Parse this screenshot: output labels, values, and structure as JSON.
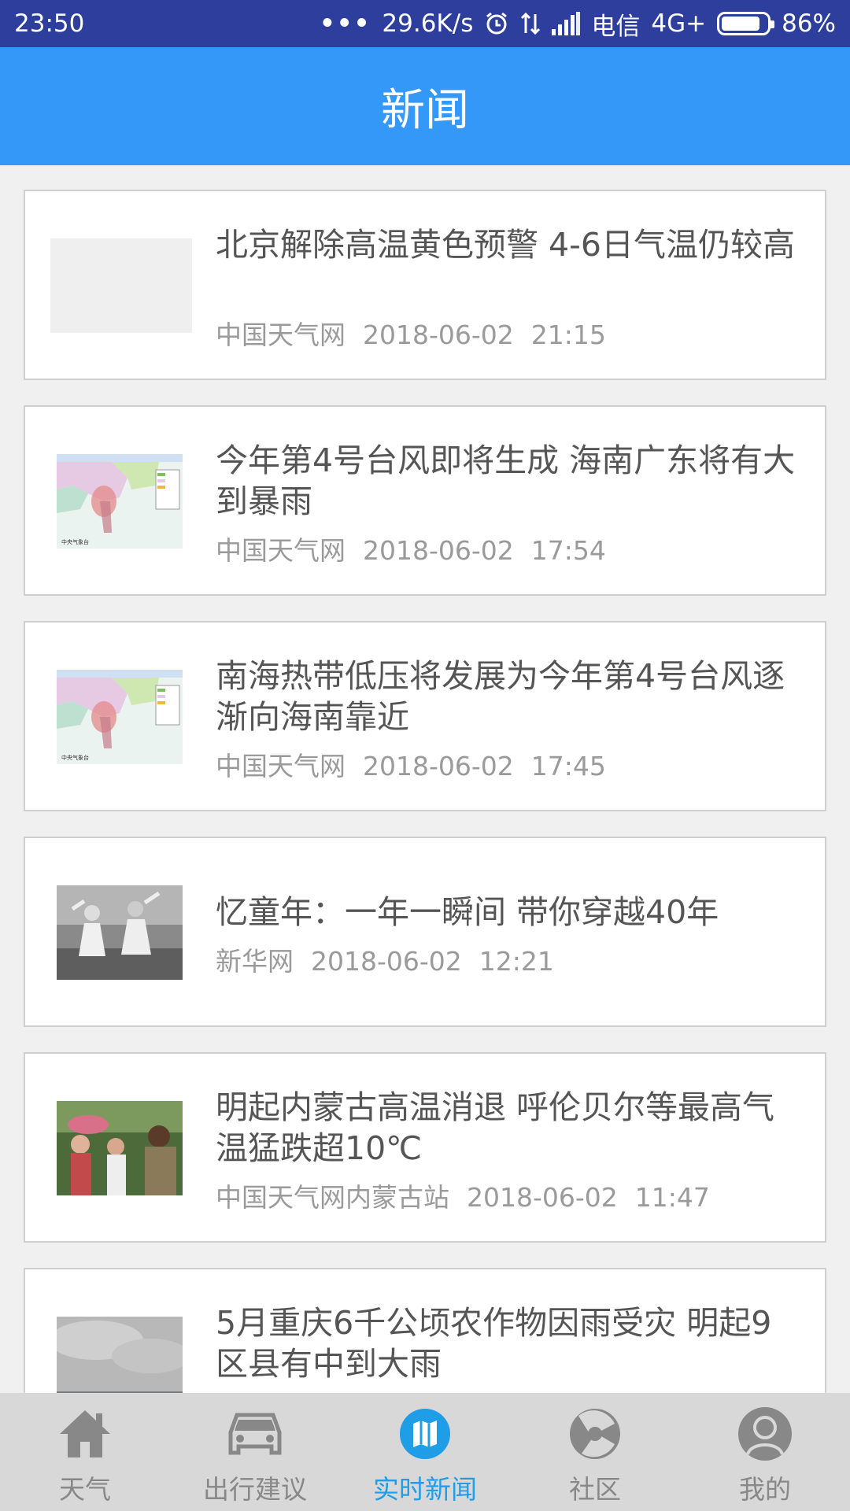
{
  "status_bar": {
    "time": "23:50",
    "network_speed": "29.6K/s",
    "carrier": "电信",
    "network_type": "4G+",
    "battery_percent": "86%",
    "battery_level": 0.86
  },
  "header": {
    "title": "新闻"
  },
  "news": [
    {
      "title": "北京解除高温黄色预警 4-6日气温仍较高",
      "source": "中国天气网",
      "date": "2018-06-02",
      "time": "21:15",
      "thumbnail": "placeholder"
    },
    {
      "title": "今年第4号台风即将生成 海南广东将有大到暴雨",
      "source": "中国天气网",
      "date": "2018-06-02",
      "time": "17:54",
      "thumbnail": "typhoon-map"
    },
    {
      "title": "南海热带低压将发展为今年第4号台风逐渐向海南靠近",
      "source": "中国天气网",
      "date": "2018-06-02",
      "time": "17:45",
      "thumbnail": "typhoon-map"
    },
    {
      "title": "忆童年：一年一瞬间 带你穿越40年",
      "source": "新华网",
      "date": "2018-06-02",
      "time": "12:21",
      "thumbnail": "children-dance-photo"
    },
    {
      "title": "明起内蒙古高温消退 呼伦贝尔等最高气温猛跌超10℃",
      "source": "中国天气网内蒙古站",
      "date": "2018-06-02",
      "time": "11:47",
      "thumbnail": "crowd-photo"
    },
    {
      "title": "5月重庆6千公顷农作物因雨受灾 明起9区县有中到大雨",
      "source": "",
      "date": "",
      "time": "",
      "thumbnail": "cloudy-sky-photo"
    }
  ],
  "bottom_nav": [
    {
      "label": "天气",
      "icon": "home-icon",
      "active": false
    },
    {
      "label": "出行建议",
      "icon": "car-icon",
      "active": false
    },
    {
      "label": "实时新闻",
      "icon": "map-book-icon",
      "active": true
    },
    {
      "label": "社区",
      "icon": "community-play-icon",
      "active": false
    },
    {
      "label": "我的",
      "icon": "user-icon",
      "active": false
    }
  ],
  "colors": {
    "status_bar": "#2d3e9c",
    "header": "#3498f8",
    "active_nav": "#1f9de6",
    "inactive_nav": "#888888"
  }
}
